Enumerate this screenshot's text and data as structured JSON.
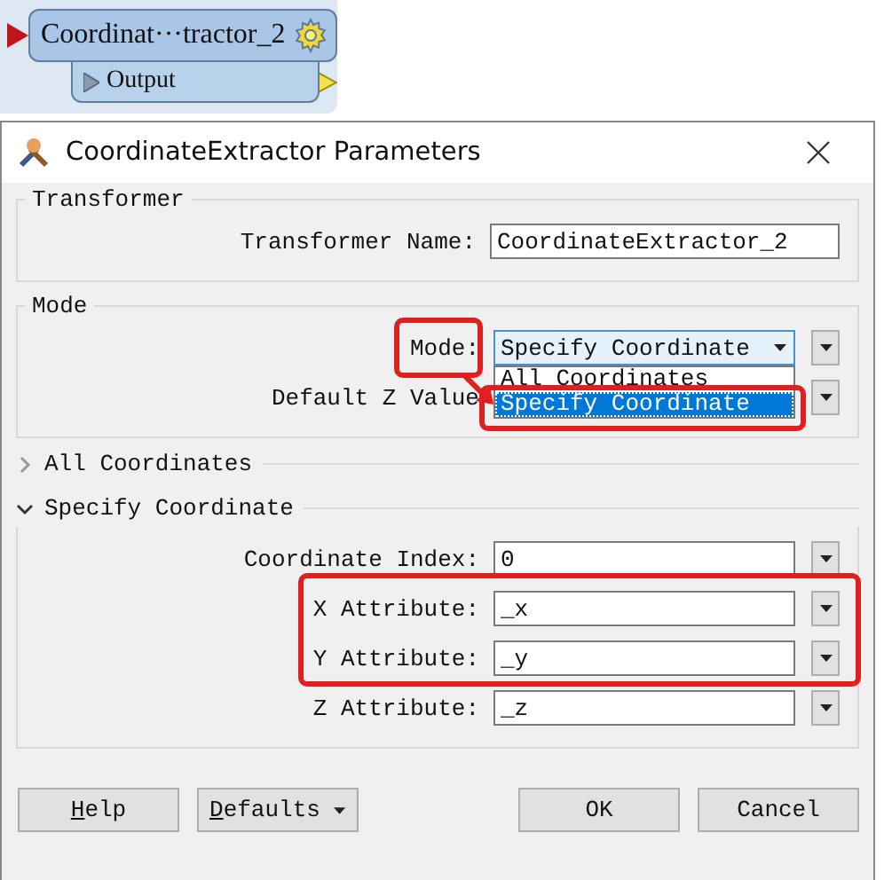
{
  "node": {
    "title": "Coordinat···tractor_2",
    "output_port": "Output"
  },
  "dialog": {
    "title": "CoordinateExtractor Parameters"
  },
  "transformer_group": {
    "title": "Transformer",
    "field": {
      "label": "Transformer Name:",
      "value": "CoordinateExtractor_2"
    }
  },
  "mode_group": {
    "title": "Mode",
    "mode": {
      "label": "Mode:",
      "value": "Specify Coordinate",
      "options": [
        {
          "label": "All Coordinates",
          "selected": false
        },
        {
          "label": "Specify Coordinate",
          "selected": true
        }
      ]
    },
    "default_z": {
      "label": "Default Z Value"
    }
  },
  "sections": [
    {
      "title": "All Coordinates",
      "expanded": false
    },
    {
      "title": "Specify Coordinate",
      "expanded": true,
      "fields": [
        {
          "label": "Coordinate Index:",
          "value": "0"
        },
        {
          "label": "X Attribute:",
          "value": "_x"
        },
        {
          "label": "Y Attribute:",
          "value": "_y"
        },
        {
          "label": "Z Attribute:",
          "value": "_z"
        }
      ]
    }
  ],
  "buttons": [
    {
      "label": "Help",
      "kind": "plain",
      "underline_first": true
    },
    {
      "label": "Defaults",
      "kind": "menu",
      "underline_first": true
    },
    {
      "label": "OK",
      "kind": "plain",
      "underline_first": false
    },
    {
      "label": "Cancel",
      "kind": "plain",
      "underline_first": false
    }
  ]
}
